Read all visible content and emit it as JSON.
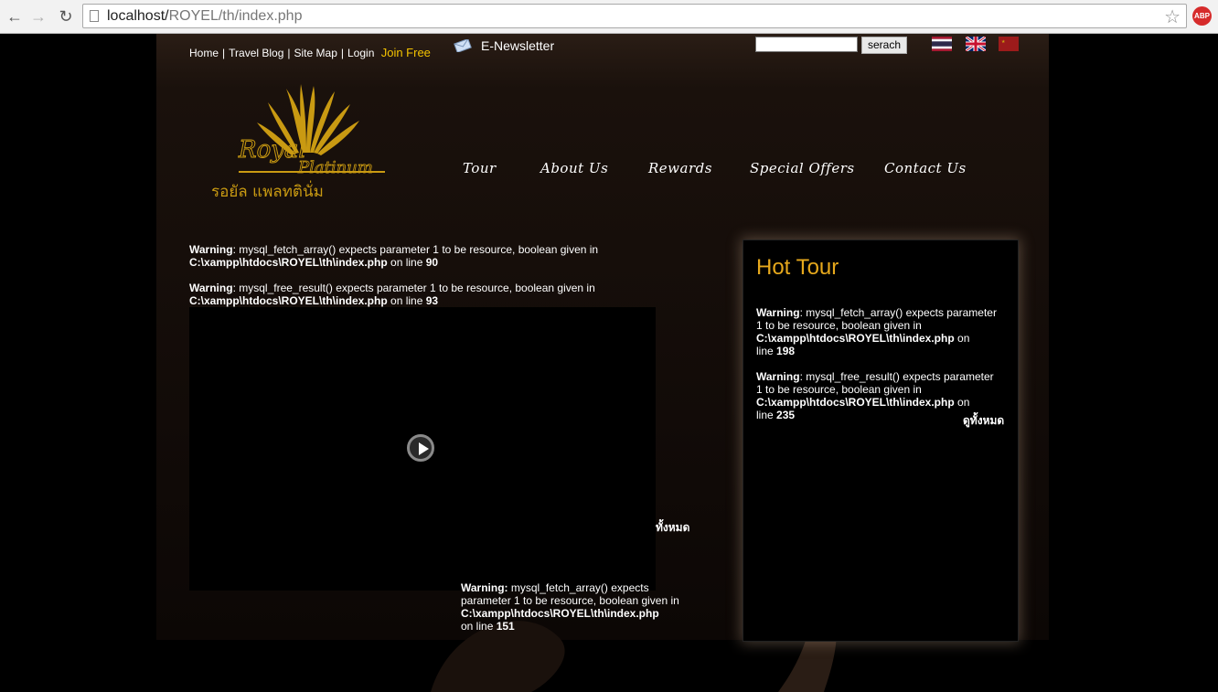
{
  "browser": {
    "url_host": "localhost/",
    "url_path": "ROYEL/th/index.php",
    "abp_label": "ABP"
  },
  "topnav": {
    "home": "Home",
    "travel_blog": "Travel Blog",
    "site_map": "Site Map",
    "login": "Login",
    "join_free": "Join Free",
    "separator": "|"
  },
  "newsletter": {
    "label": "E-Newsletter"
  },
  "search": {
    "button_label": "serach",
    "value": ""
  },
  "languages": [
    "thai-flag",
    "uk-flag",
    "china-flag"
  ],
  "logo": {
    "line1": "Royal Platinum",
    "line2": "รอยัล แพลทตินั่ม"
  },
  "mainnav": [
    "Tour",
    "About Us",
    "Rewards",
    "Special Offers",
    "Contact Us"
  ],
  "main": {
    "warn1": {
      "label": "Warning",
      "msg": ": mysql_fetch_array() expects parameter 1 to be resource, boolean given in",
      "file": "C:\\xampp\\htdocs\\ROYEL\\th\\index.php",
      "on_line": " on line ",
      "line": "90"
    },
    "warn2": {
      "label": "Warning",
      "msg": ": mysql_free_result() expects parameter 1 to be resource, boolean given in",
      "file": "C:\\xampp\\htdocs\\ROYEL\\th\\index.php",
      "on_line": " on line ",
      "line": "93"
    },
    "view_all": "ทั้งหมด",
    "warn3": {
      "label": "Warning:",
      "msg1": " mysql_fetch_array() expects",
      "msg2": "parameter 1 to be resource, boolean given in",
      "file": "C:\\xampp\\htdocs\\ROYEL\\th\\index.php",
      "on_line": "on line ",
      "line": "151"
    }
  },
  "hot_tour": {
    "title": "Hot Tour",
    "warn1": {
      "label": "Warning",
      "msg1": ": mysql_fetch_array() expects parameter",
      "msg2": "1 to be resource, boolean given in",
      "file": "C:\\xampp\\htdocs\\ROYEL\\th\\index.php",
      "on_line": " on",
      "line_word": "line ",
      "line": "198"
    },
    "warn2": {
      "label": "Warning",
      "msg1": ": mysql_free_result() expects parameter",
      "msg2": "1 to be resource, boolean given in",
      "file": "C:\\xampp\\htdocs\\ROYEL\\th\\index.php",
      "on_line": " on",
      "line_word": "line ",
      "line": "235"
    },
    "view_all": "ดูทั้งหมด"
  },
  "colors": {
    "accent_gold": "#e6a81c",
    "join_yellow": "#f4c300"
  }
}
